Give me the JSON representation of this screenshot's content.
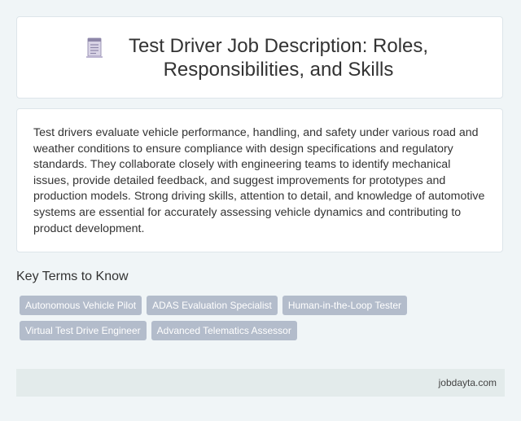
{
  "header": {
    "icon": "document-icon",
    "title": "Test Driver Job Description: Roles, Responsibilities, and Skills"
  },
  "description": "Test drivers evaluate vehicle performance, handling, and safety under various road and weather conditions to ensure compliance with design specifications and regulatory standards. They collaborate closely with engineering teams to identify mechanical issues, provide detailed feedback, and suggest improvements for prototypes and production models. Strong driving skills, attention to detail, and knowledge of automotive systems are essential for accurately assessing vehicle dynamics and contributing to product development.",
  "key_terms": {
    "heading": "Key Terms to Know",
    "tags": [
      "Autonomous Vehicle Pilot",
      "ADAS Evaluation Specialist",
      "Human-in-the-Loop Tester",
      "Virtual Test Drive Engineer",
      "Advanced Telematics Assessor"
    ]
  },
  "footer": {
    "site": "jobdayta.com"
  },
  "colors": {
    "background": "#f0f5f7",
    "tag_background": "#b3bccb",
    "footer_background": "#e3ebeb"
  }
}
